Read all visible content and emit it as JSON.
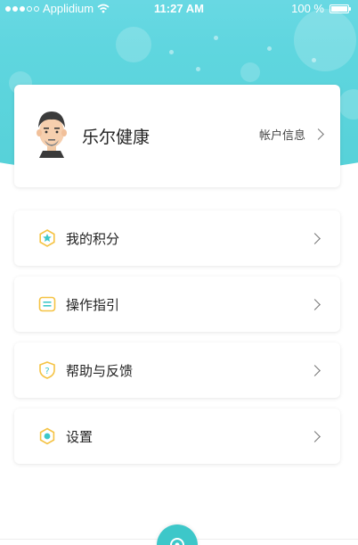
{
  "status_bar": {
    "carrier": "Applidium",
    "time": "11:27 AM",
    "battery": "100 %"
  },
  "profile": {
    "name": "乐尔健康",
    "account_label": "帐户信息"
  },
  "menu": {
    "items": [
      {
        "label": "我的积分",
        "icon": "points-icon"
      },
      {
        "label": "操作指引",
        "icon": "guide-icon"
      },
      {
        "label": "帮助与反馈",
        "icon": "help-icon"
      },
      {
        "label": "设置",
        "icon": "settings-icon"
      }
    ]
  },
  "colors": {
    "header": "#5fd6df",
    "accent_yellow": "#f5c344",
    "accent_teal": "#3dc7c9"
  }
}
